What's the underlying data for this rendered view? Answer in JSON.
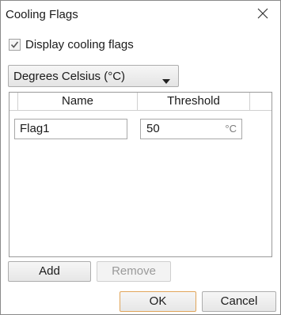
{
  "dialog": {
    "title": "Cooling Flags"
  },
  "display_checkbox": {
    "label": "Display cooling flags",
    "checked": true
  },
  "unit_dropdown": {
    "selected": "Degrees Celsius (°C)"
  },
  "grid": {
    "columns": [
      "Name",
      "Threshold"
    ],
    "rows": [
      {
        "name": "Flag1",
        "threshold": "50",
        "unit": "°C"
      }
    ]
  },
  "buttons": {
    "add": "Add",
    "remove": "Remove",
    "ok": "OK",
    "cancel": "Cancel"
  },
  "colors": {
    "ok_border": "#e0a55a",
    "disabled_text": "#9a9a9a"
  }
}
